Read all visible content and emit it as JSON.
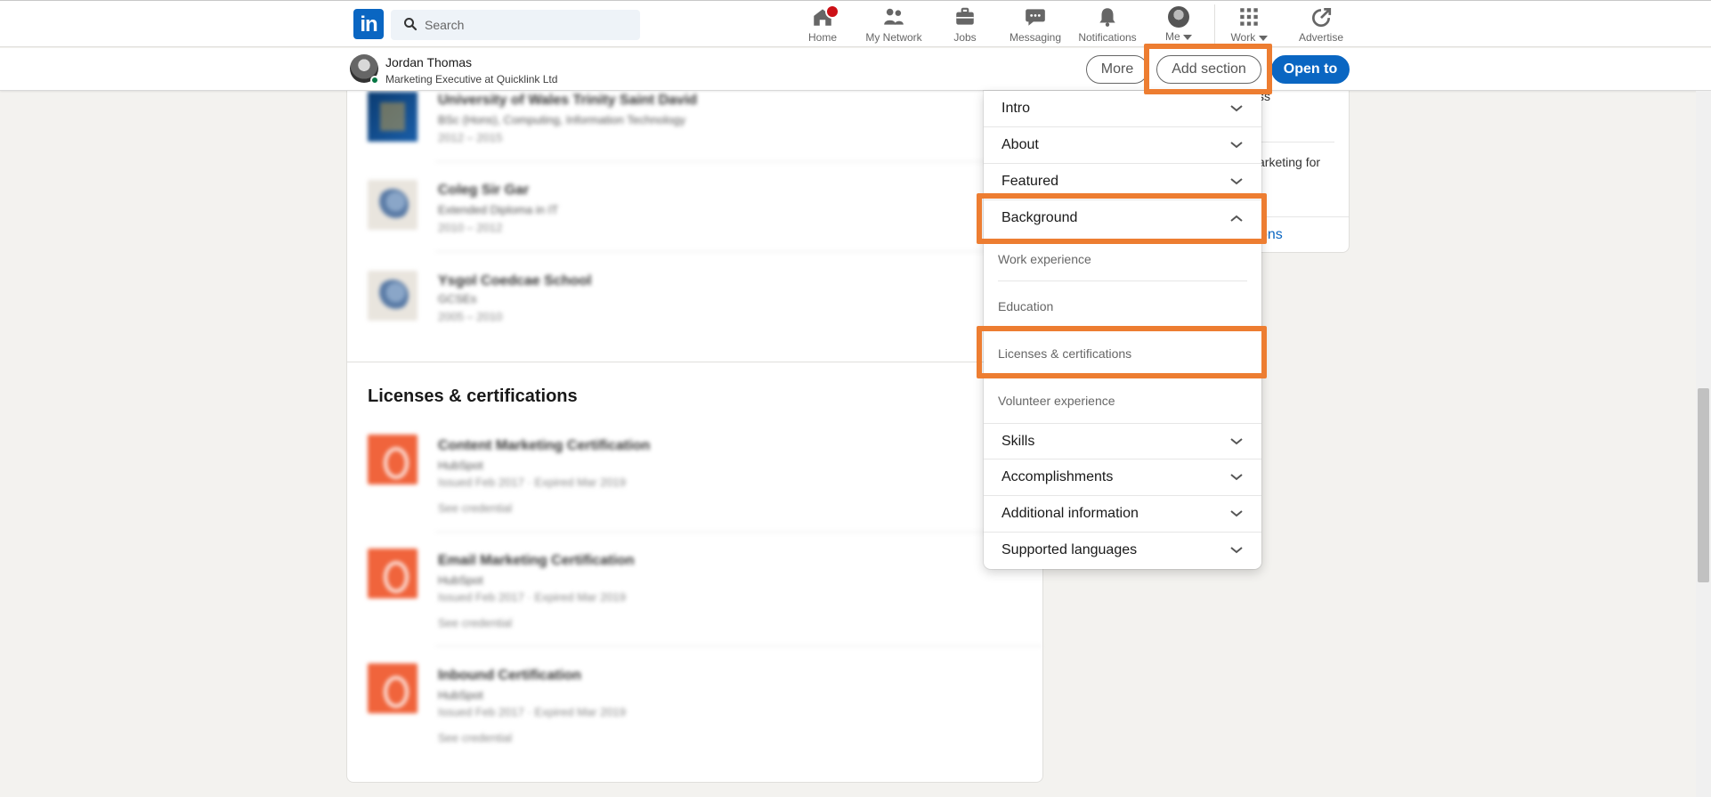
{
  "nav": {
    "logo_text": "in",
    "search_placeholder": "Search",
    "items": [
      {
        "label": "Home",
        "icon": "home-icon"
      },
      {
        "label": "My Network",
        "icon": "network-icon"
      },
      {
        "label": "Jobs",
        "icon": "briefcase-icon"
      },
      {
        "label": "Messaging",
        "icon": "messaging-icon"
      },
      {
        "label": "Notifications",
        "icon": "bell-icon"
      },
      {
        "label": "Me",
        "icon": "avatar"
      },
      {
        "label": "Work",
        "icon": "grid-icon"
      },
      {
        "label": "Advertise",
        "icon": "advertise-icon"
      }
    ],
    "accent": "#0a66c2",
    "badge_color": "#cc1016"
  },
  "profile_bar": {
    "name": "Jordan Thomas",
    "headline": "Marketing Executive at Quicklink Ltd",
    "more_label": "More",
    "add_section_label": "Add section",
    "open_to_label": "Open to"
  },
  "education": [
    {
      "school": "University of Wales Trinity Saint David",
      "degree": "BSc (Hons), Computing, Information Technology",
      "dates": "2012 – 2015"
    },
    {
      "school": "Coleg Sir Gar",
      "degree": "Extended Diploma in IT",
      "dates": "2010 – 2012"
    },
    {
      "school": "Ysgol Coedcae School",
      "degree": "GCSEs",
      "dates": "2005 – 2010"
    }
  ],
  "licenses": {
    "title": "Licenses & certifications",
    "items": [
      {
        "name": "Content Marketing Certification",
        "issuer": "HubSpot",
        "dates": "Issued Feb 2017 · Expired Mar 2019",
        "cta": "See credential"
      },
      {
        "name": "Email Marketing Certification",
        "issuer": "HubSpot",
        "dates": "Issued Feb 2017 · Expired Mar 2019",
        "cta": "See credential"
      },
      {
        "name": "Inbound Certification",
        "issuer": "HubSpot",
        "dates": "Issued Feb 2017 · Expired Mar 2019",
        "cta": "See credential"
      }
    ]
  },
  "right_rail": {
    "text1": "ss",
    "text2": "arketing for",
    "link": "ons"
  },
  "add_section_menu": {
    "sections": [
      {
        "label": "Intro",
        "expanded": false
      },
      {
        "label": "About",
        "expanded": false
      },
      {
        "label": "Featured",
        "expanded": false
      },
      {
        "label": "Background",
        "expanded": true
      }
    ],
    "background_items": [
      "Work experience",
      "Education",
      "Licenses & certifications",
      "Volunteer experience"
    ],
    "more_sections": [
      {
        "label": "Skills",
        "expanded": false
      },
      {
        "label": "Accomplishments",
        "expanded": false
      },
      {
        "label": "Additional information",
        "expanded": false
      },
      {
        "label": "Supported languages",
        "expanded": false
      }
    ]
  },
  "highlight_color": "#ed7d31"
}
